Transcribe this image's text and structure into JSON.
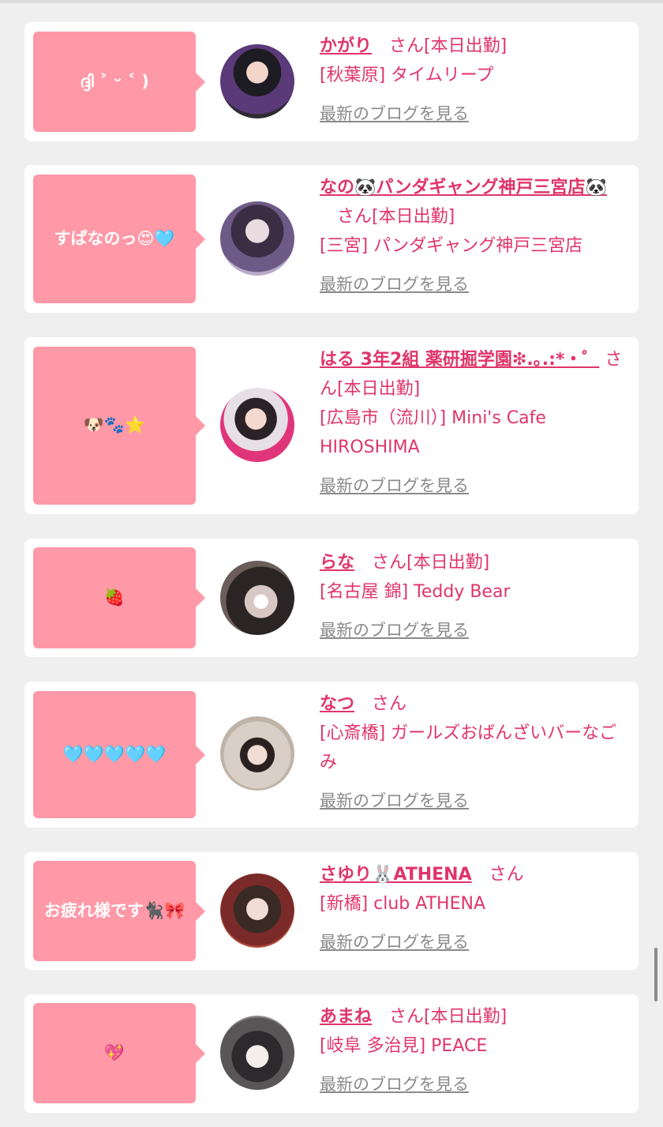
{
  "blog_link_label": "最新のブログを見る",
  "colors": {
    "accent": "#e0356a",
    "bubble": "#ff98a7",
    "link_gray": "#8a8a8a"
  },
  "entries": [
    {
      "message": "ദ്ദി ˃ ᵕ ˂ )",
      "name": "かがり",
      "status": "さん[本日出勤]",
      "shop": "[秋葉原] タイムリープ"
    },
    {
      "message": "すぱなのっ😍🩵",
      "name": "なの🐼パンダギャング神戸三宮店🐼",
      "status": "さん[本日出勤]",
      "shop": "[三宮] パンダギャング神戸三宮店"
    },
    {
      "message": "🐶🐾⭐",
      "name": "はる 3年2組 薬研掘学園❇︎.｡.:*・゜",
      "status": "さん[本日出勤]",
      "shop": "[広島市（流川）] Mini's Cafe HIROSHIMA"
    },
    {
      "message": "🍓",
      "name": "らな",
      "status": "さん[本日出勤]",
      "shop": "[名古屋 錦] Teddy Bear"
    },
    {
      "message": "🩵🩵🩵🩵🩵",
      "name": "なつ",
      "status": "さん",
      "shop": "[心斎橋] ガールズおばんざいバーなごみ"
    },
    {
      "message": "お疲れ様です🐈‍⬛🎀",
      "name": "さゆり🐰ATHENA",
      "status": "さん",
      "shop": "[新橋] club ATHENA"
    },
    {
      "message": "💖",
      "name": "あまね",
      "status": "さん[本日出勤]",
      "shop": "[岐阜 多治見] PEACE"
    }
  ]
}
